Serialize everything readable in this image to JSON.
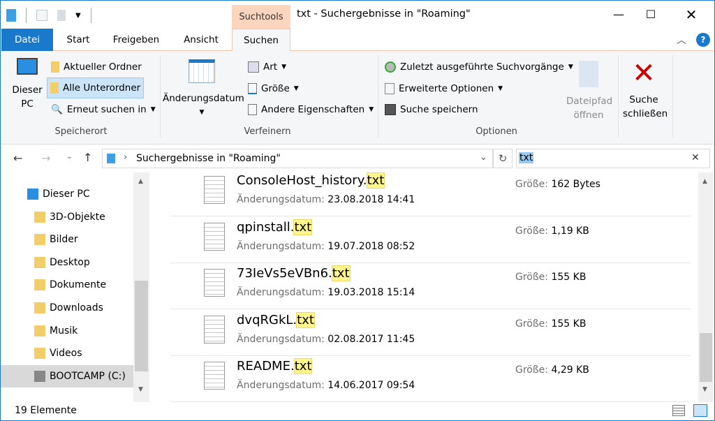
{
  "window": {
    "title": "txt - Suchergebnisse in \"Roaming\"",
    "contextual_tab": "Suchtools"
  },
  "tabs": [
    {
      "label": "Datei"
    },
    {
      "label": "Start"
    },
    {
      "label": "Freigeben"
    },
    {
      "label": "Ansicht"
    },
    {
      "label": "Suchen"
    }
  ],
  "ribbon": {
    "speicherort": {
      "label": "Speicherort",
      "dieser_pc": "Dieser PC",
      "aktueller": "Aktueller Ordner",
      "alle": "Alle Unterordner",
      "erneut": "Erneut suchen in"
    },
    "verfeinern": {
      "label": "Verfeinern",
      "datum": "Änderungsdatum",
      "art": "Art",
      "groesse": "Größe",
      "andere": "Andere Eigenschaften"
    },
    "optionen": {
      "label": "Optionen",
      "zuletzt": "Zuletzt ausgeführte Suchvorgänge",
      "erweitert": "Erweiterte Optionen",
      "speichern": "Suche speichern",
      "dateipfad": "Dateipfad öffnen"
    },
    "schliessen": "Suche schließen"
  },
  "address": {
    "path": "Suchergebnisse in \"Roaming\"",
    "search_value": "txt"
  },
  "nav": [
    {
      "label": "Dieser PC"
    },
    {
      "label": "3D-Objekte"
    },
    {
      "label": "Bilder"
    },
    {
      "label": "Desktop"
    },
    {
      "label": "Dokumente"
    },
    {
      "label": "Downloads"
    },
    {
      "label": "Musik"
    },
    {
      "label": "Videos"
    },
    {
      "label": "BOOTCAMP (C:)",
      "selected": true
    }
  ],
  "files": [
    {
      "base": "ConsoleHost_history.",
      "match": "txt",
      "date_label": "Änderungsdatum:",
      "date": "23.08.2018 14:41",
      "size_label": "Größe:",
      "size": "162 Bytes"
    },
    {
      "base": "qpinstall.",
      "match": "txt",
      "date_label": "Änderungsdatum:",
      "date": "19.07.2018 08:52",
      "size_label": "Größe:",
      "size": "1,19 KB"
    },
    {
      "base": "73IeVs5eVBn6.",
      "match": "txt",
      "date_label": "Änderungsdatum:",
      "date": "19.03.2018 15:14",
      "size_label": "Größe:",
      "size": "155 KB"
    },
    {
      "base": "dvqRGkL.",
      "match": "txt",
      "date_label": "Änderungsdatum:",
      "date": "02.08.2017 11:45",
      "size_label": "Größe:",
      "size": "155 KB"
    },
    {
      "base": "README.",
      "match": "txt",
      "date_label": "Änderungsdatum:",
      "date": "14.06.2017 09:54",
      "size_label": "Größe:",
      "size": "4,29 KB"
    }
  ],
  "status": {
    "count": "19 Elemente"
  },
  "colors": {
    "accent": "#1979ca",
    "contextual": "#fbd5bd",
    "highlight": "#fff58c"
  }
}
